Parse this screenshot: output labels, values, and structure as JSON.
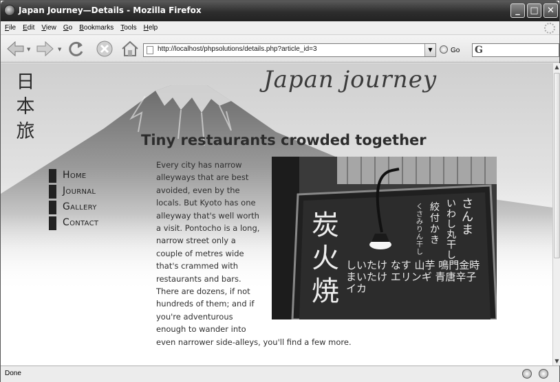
{
  "window": {
    "title": "Japan Journey—Details - Mozilla Firefox",
    "buttons": {
      "minimize": "_",
      "maximize": "□",
      "close": "✕"
    }
  },
  "menu": [
    "File",
    "Edit",
    "View",
    "Go",
    "Bookmarks",
    "Tools",
    "Help"
  ],
  "toolbar": {
    "url": "http://localhost/phpsolutions/details.php?article_id=3",
    "go_label": "Go",
    "search_engine_glyph": "G",
    "icons": [
      "back-icon",
      "forward-icon",
      "reload-icon",
      "stop-icon",
      "home-icon"
    ]
  },
  "page": {
    "kanji": "日本旅",
    "site_title": "Japan journey",
    "heading": "Tiny restaurants crowded together",
    "nav": [
      "Home",
      "Journal",
      "Gallery",
      "Contact"
    ],
    "article": "Every city has narrow alleyways that are best avoided, even by the locals. But Kyoto has one alleyway that's well worth a visit. Pontocho is a long, narrow street only a couple of metres wide that's crammed with restaurants and bars. There are dozens, if not hundreds of them; and if you're adventurous enough to wander into even narrower side-alleys, you'll find a few more.",
    "photo_signs": {
      "big": "炭火焼",
      "col1": "さんま",
      "col2": "いわし丸干し",
      "col3": "絞付かき",
      "col4": "くさみりん干し",
      "lower": "しいたけ なす 山芋 鳴門金時 まいたけ エリンギ 青唐辛子 イカ"
    }
  },
  "status": {
    "text": "Done"
  },
  "colors": {
    "titlebar": "#2e2e2e",
    "page_bg": "#ffffff",
    "text": "#2e2e2e",
    "nav_marker": "#222222"
  }
}
